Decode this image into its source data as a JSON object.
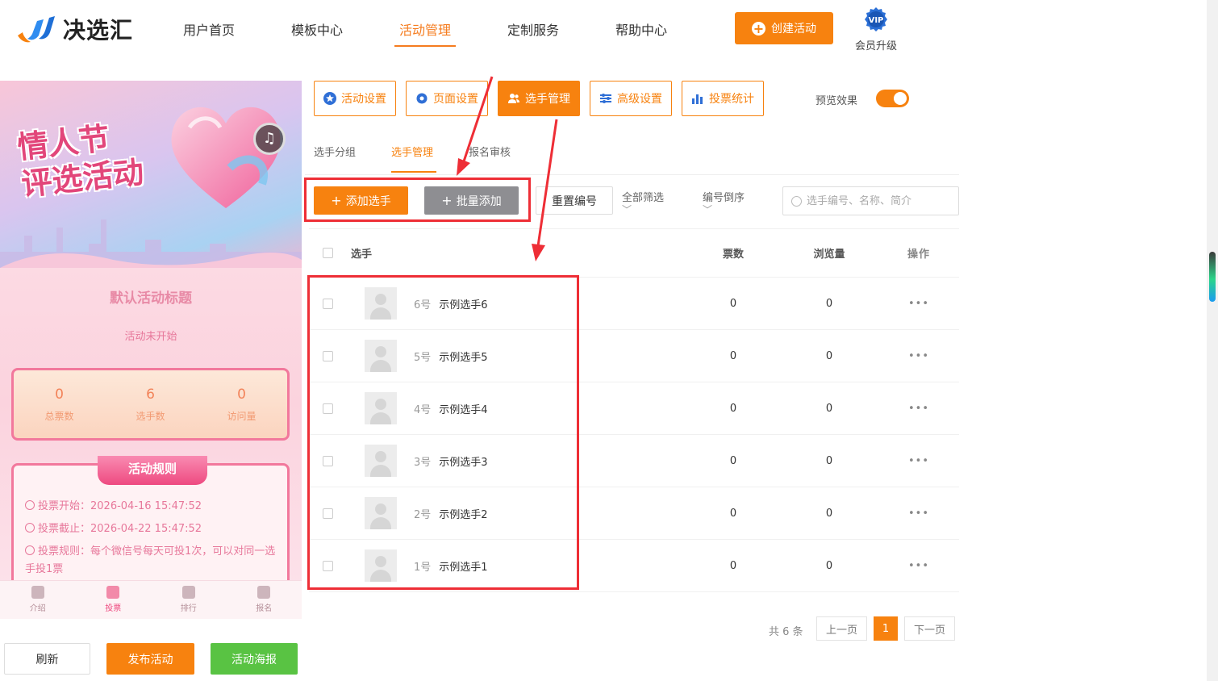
{
  "brand": {
    "name": "决选汇"
  },
  "nav": {
    "items": [
      "用户首页",
      "模板中心",
      "活动管理",
      "定制服务",
      "帮助中心"
    ],
    "active_index": 2,
    "create_label": "创建活动",
    "vip_label": "会员升级",
    "vip_badge": "VIP"
  },
  "preview": {
    "banner_line1": "情人节",
    "banner_line2": "评选活动",
    "activity_title": "默认活动标题",
    "status": "活动未开始",
    "stats": [
      {
        "value": "0",
        "label": "总票数"
      },
      {
        "value": "6",
        "label": "选手数"
      },
      {
        "value": "0",
        "label": "访问量"
      }
    ],
    "rules_title": "活动规则",
    "rules": [
      "投票开始：2026-04-16 15:47:52",
      "投票截止：2026-04-22 15:47:52",
      "投票规则：每个微信号每天可投1次，可以对同一选手投1票"
    ],
    "tabs": [
      "介绍",
      "投票",
      "排行",
      "报名"
    ],
    "active_tab": 1
  },
  "bottom_buttons": {
    "refresh": "刷新",
    "publish": "发布活动",
    "poster": "活动海报"
  },
  "settings_buttons": [
    "活动设置",
    "页面设置",
    "选手管理",
    "高级设置",
    "投票统计"
  ],
  "settings_active_index": 2,
  "preview_toggle": {
    "label": "预览效果",
    "on": true
  },
  "sub_tabs": [
    "选手分组",
    "选手管理",
    "报名审核"
  ],
  "sub_tab_active": 1,
  "toolbar": {
    "add": "添加选手",
    "batch_add": "批量添加",
    "renumber": "重置编号",
    "filter_all": "全部筛选",
    "sort": "编号倒序",
    "search_placeholder": "选手编号、名称、简介"
  },
  "table": {
    "headers": {
      "player": "选手",
      "votes": "票数",
      "views": "浏览量",
      "ops": "操作"
    },
    "rows": [
      {
        "num": "6号",
        "name": "示例选手6",
        "votes": "0",
        "views": "0",
        "op": "•••"
      },
      {
        "num": "5号",
        "name": "示例选手5",
        "votes": "0",
        "views": "0",
        "op": "•••"
      },
      {
        "num": "4号",
        "name": "示例选手4",
        "votes": "0",
        "views": "0",
        "op": "•••"
      },
      {
        "num": "3号",
        "name": "示例选手3",
        "votes": "0",
        "views": "0",
        "op": "•••"
      },
      {
        "num": "2号",
        "name": "示例选手2",
        "votes": "0",
        "views": "0",
        "op": "•••"
      },
      {
        "num": "1号",
        "name": "示例选手1",
        "votes": "0",
        "views": "0",
        "op": "•••"
      }
    ]
  },
  "pagination": {
    "total": "共 6 条",
    "prev": "上一页",
    "current": "1",
    "next": "下一页"
  },
  "colors": {
    "accent": "#f7820f",
    "annotation": "#ee2e36",
    "pink": "#f2789c",
    "green": "#59c343"
  }
}
